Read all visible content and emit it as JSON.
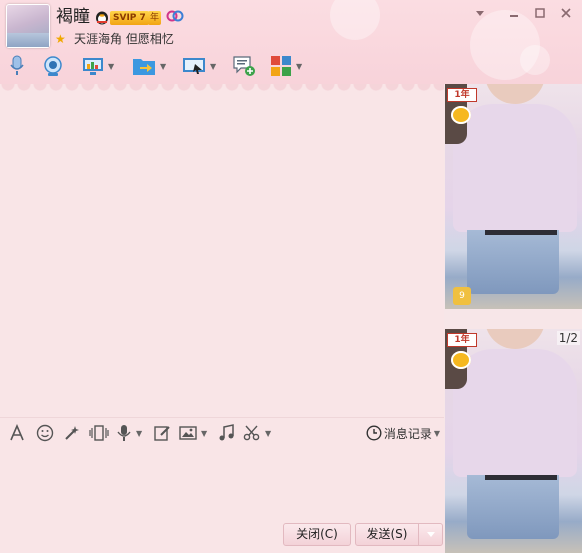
{
  "contact": {
    "nickname": "褐瞳",
    "svip_label": "SVIP 7",
    "year_label": "年",
    "signature": "天涯海角 但愿相忆"
  },
  "window_controls": [
    "dropdown",
    "minimize",
    "maximize",
    "close"
  ],
  "toolbar": {
    "items": [
      {
        "icon": "microphone-icon"
      },
      {
        "icon": "webcam-icon"
      },
      {
        "icon": "remote-desktop-icon",
        "has_dropdown": true
      },
      {
        "icon": "file-transfer-icon",
        "has_dropdown": true
      },
      {
        "icon": "screen-share-icon",
        "has_dropdown": true
      },
      {
        "icon": "create-discussion-icon"
      },
      {
        "icon": "apps-icon",
        "has_dropdown": true
      }
    ]
  },
  "input_toolbar": {
    "items": [
      "font-icon",
      "emoji-icon",
      "shake-icon",
      "screenshot-icon",
      "voice-icon",
      "edit-icon",
      "image-icon",
      "music-icon",
      "scissors-icon"
    ],
    "history_label": "消息记录"
  },
  "buttons": {
    "close_label": "关闭(C)",
    "send_label": "发送(S)"
  },
  "side": {
    "photo_tag": "1年",
    "page_indicator": "1/2",
    "thumb_badge": "9"
  },
  "colors": {
    "header_bg": "#f8d3da",
    "chat_bg": "#f9e5e7",
    "accent": "#e2b9c0"
  }
}
